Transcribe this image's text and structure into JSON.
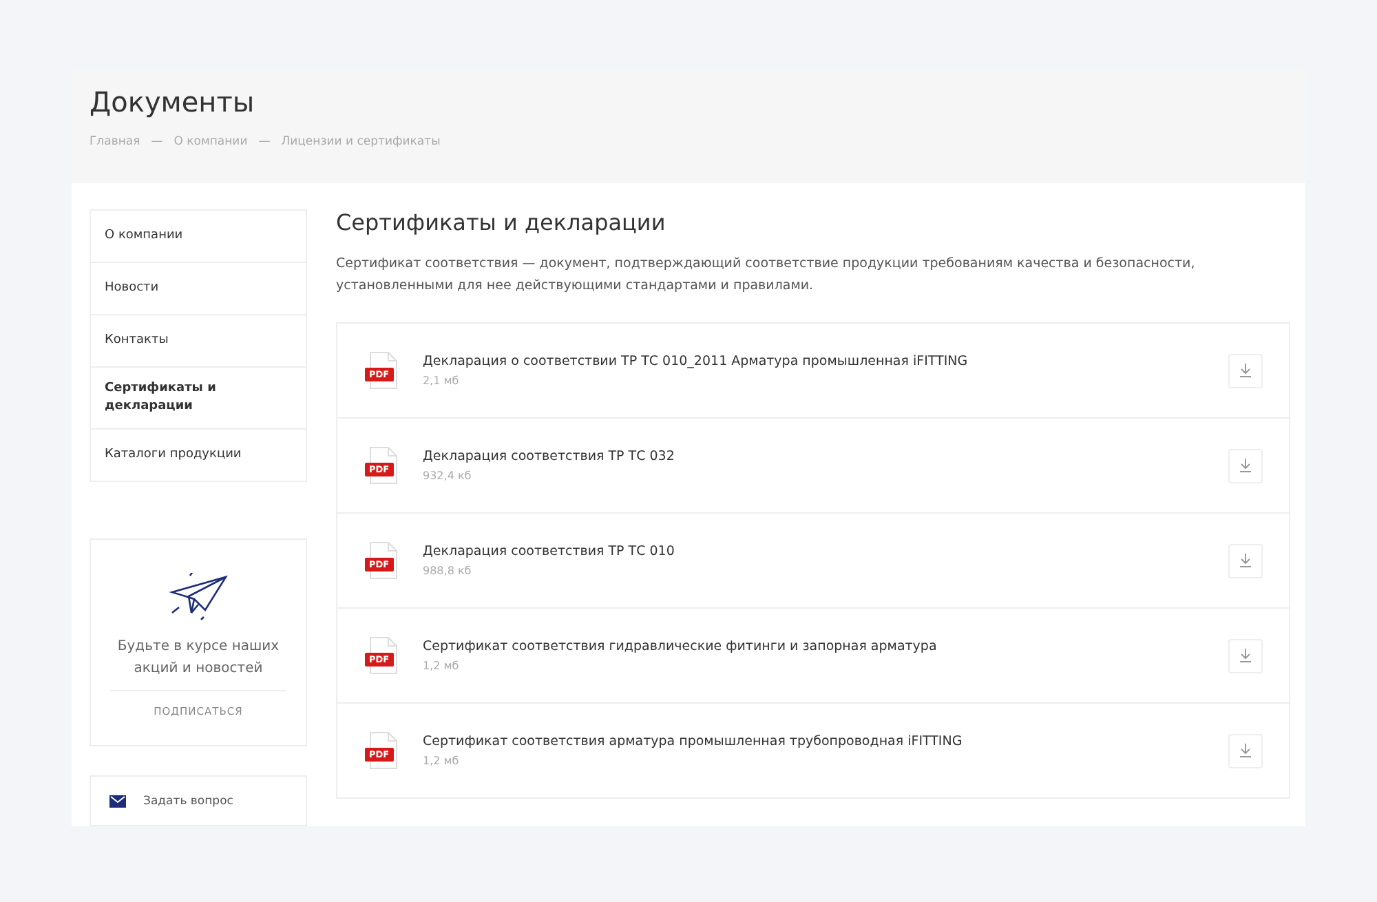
{
  "page": {
    "title": "Документы"
  },
  "breadcrumbs": [
    "Главная",
    "О компании",
    "Лицензии и сертификаты"
  ],
  "breadcrumb_separator": "—",
  "sidebar": {
    "items": [
      {
        "label": "О компании",
        "selected": false
      },
      {
        "label": "Новости",
        "selected": false
      },
      {
        "label": "Контакты",
        "selected": false
      },
      {
        "label": "Сертификаты и декларации",
        "selected": true
      },
      {
        "label": "Каталоги продукции",
        "selected": false
      }
    ],
    "subscribe": {
      "text": "Будьте в курсе наших акций и новостей",
      "button": "ПОДПИСАТЬСЯ"
    },
    "question": {
      "label": "Задать вопрос"
    }
  },
  "content": {
    "title": "Сертификаты и декларации",
    "description": "Сертификат соответствия — документ, подтверждающий соответствие продукции требованиям качества и безопасности, установленными для нее действующими стандартами и правилами.",
    "documents": [
      {
        "badge": "PDF",
        "name": "Декларация о соответствии ТР ТС 010_2011 Арматура промышленная iFITTING",
        "size": "2,1 мб"
      },
      {
        "badge": "PDF",
        "name": "Декларация соответствия ТР ТС 032",
        "size": "932,4 кб"
      },
      {
        "badge": "PDF",
        "name": "Декларация соответствия ТР ТС 010",
        "size": "988,8 кб"
      },
      {
        "badge": "PDF",
        "name": "Сертификат соответствия гидравлические фитинги и запорная арматура",
        "size": "1,2 мб"
      },
      {
        "badge": "PDF",
        "name": "Сертификат соответствия арматура промышленная трубопроводная iFITTING",
        "size": "1,2 мб"
      }
    ]
  }
}
